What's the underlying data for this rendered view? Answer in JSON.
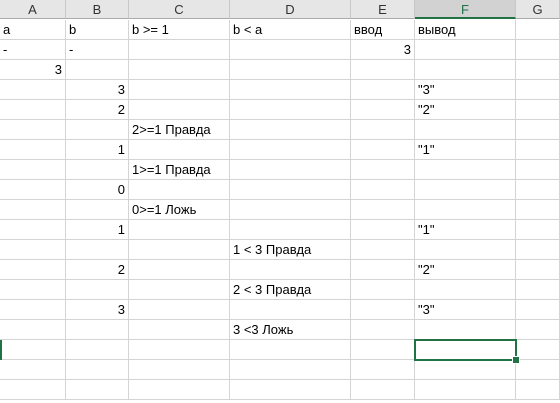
{
  "columns": [
    "A",
    "B",
    "C",
    "D",
    "E",
    "F",
    "G"
  ],
  "selected_column": "F",
  "selected_cell": "F17",
  "accent_color": "#217346",
  "rows": [
    {
      "A": "a",
      "B": "b",
      "C": "b >= 1",
      "D": "b < a",
      "E": "ввод",
      "F": "вывод"
    },
    {
      "A": " -",
      "B": " -"
    },
    {
      "A": "3"
    },
    {
      "B": "3",
      "F": "\"3\""
    },
    {
      "B": "2",
      "F": "\"2\""
    },
    {
      "C": "2>=1 Правда"
    },
    {
      "B": "1",
      "F": "\"1\""
    },
    {
      "C": "1>=1 Правда"
    },
    {
      "B": "0"
    },
    {
      "C": "0>=1 Ложь"
    },
    {
      "B": "1",
      "F": "\"1\""
    },
    {
      "D": "1 < 3 Правда"
    },
    {
      "B": "2",
      "F": "\"2\""
    },
    {
      "D": "2 < 3 Правда"
    },
    {
      "B": "3",
      "F": "\"3\""
    },
    {
      "D": "3 <3 Ложь"
    },
    {},
    {},
    {}
  ],
  "row1_e2": "3"
}
